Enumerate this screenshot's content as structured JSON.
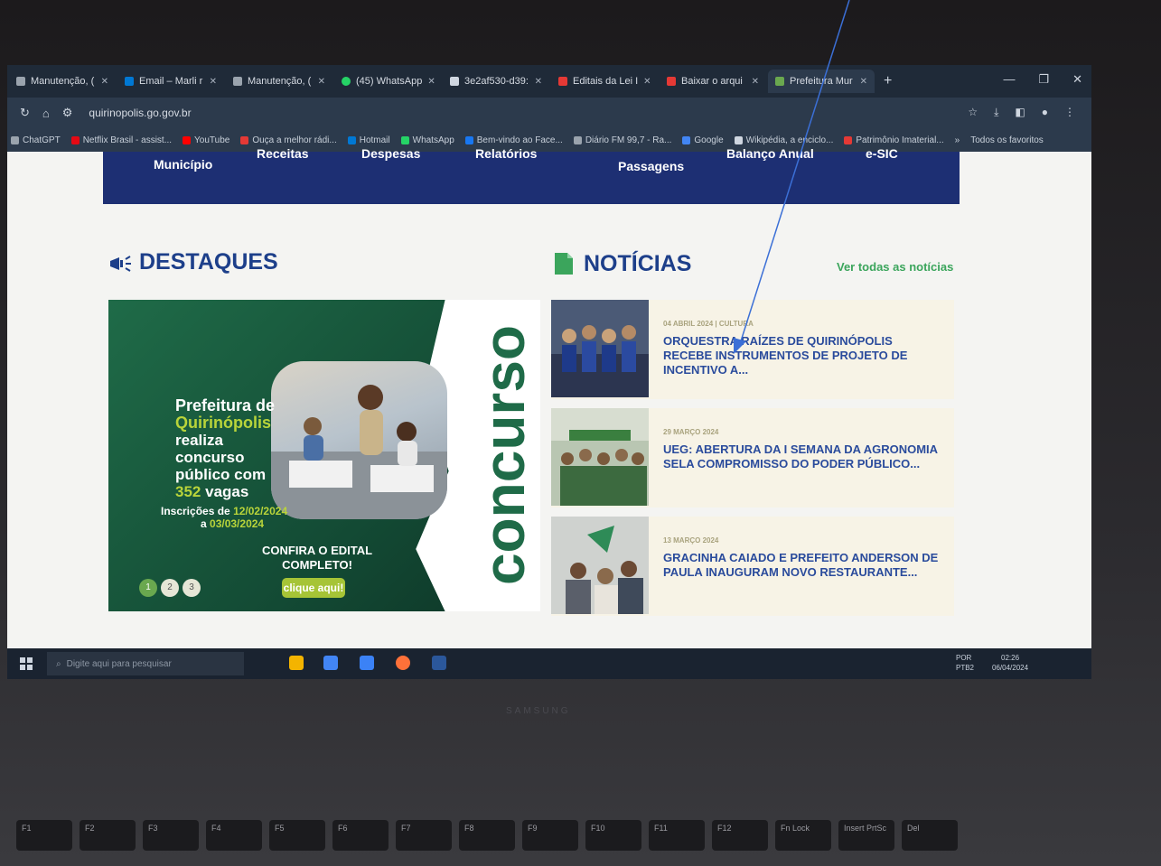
{
  "browser": {
    "tabs": [
      {
        "label": "Manutenção, ("
      },
      {
        "label": "Email – Marli r"
      },
      {
        "label": "Manutenção, ("
      },
      {
        "label": "(45) WhatsApp"
      },
      {
        "label": "3e2af530-d39:"
      },
      {
        "label": "Editais da Lei I"
      },
      {
        "label": "Baixar o arqui"
      },
      {
        "label": "Prefeitura Mur"
      }
    ],
    "new_tab": "+",
    "url": "quirinopolis.go.gov.br",
    "bookmarks": [
      {
        "label": "ChatGPT",
        "color": "#9aa3ad"
      },
      {
        "label": "Netflix Brasil - assist...",
        "color": "#e50914"
      },
      {
        "label": "YouTube",
        "color": "#ff0000"
      },
      {
        "label": "Ouça a melhor rádi...",
        "color": "#e53935"
      },
      {
        "label": "Hotmail",
        "color": "#0078d4"
      },
      {
        "label": "WhatsApp",
        "color": "#25d366"
      },
      {
        "label": "Bem-vindo ao Face...",
        "color": "#1877f2"
      },
      {
        "label": "Diário FM 99,7 - Ra...",
        "color": "#9aa3ad"
      },
      {
        "label": "Google",
        "color": "#4285f4"
      },
      {
        "label": "Wikipédia, a enciclo...",
        "color": "#cfd6e0"
      },
      {
        "label": "Patrimônio Imaterial...",
        "color": "#e53935"
      }
    ],
    "bookmarks_more": "»",
    "all_favorites": "Todos os favoritos"
  },
  "site": {
    "menu": [
      "Município",
      "Receitas",
      "Despesas",
      "Relatórios",
      "Passagens",
      "Balanço Anual",
      "e-SIC"
    ],
    "destaques_title": "DESTAQUES",
    "noticias_title": "NOTÍCIAS",
    "see_all": "Ver todas as notícias",
    "banner": {
      "vertical_word": "concurso",
      "line1": "Prefeitura de",
      "line2": "Quirinópolis",
      "line3": "realiza",
      "line4": "concurso",
      "line5": "público com",
      "vagas_number": "352",
      "vagas_word": "vagas",
      "inscricoes_label": "Inscrições de",
      "date_start": "12/02/2024",
      "date_sep": "a",
      "date_end": "03/03/2024",
      "cta_line1": "CONFIRA O EDITAL",
      "cta_line2": "COMPLETO!",
      "button": "clique aqui!",
      "pages": [
        "1",
        "2",
        "3"
      ]
    },
    "news": [
      {
        "date": "04 ABRIL 2024 | CULTURA",
        "title": "ORQUESTRA RAÍZES DE QUIRINÓPOLIS RECEBE INSTRUMENTOS DE PROJETO DE INCENTIVO A..."
      },
      {
        "date": "29 MARÇO 2024",
        "title": "UEG: ABERTURA DA I SEMANA DA AGRONOMIA SELA COMPROMISSO DO PODER PÚBLICO..."
      },
      {
        "date": "13 MARÇO 2024",
        "title": "GRACINHA CAIADO E PREFEITO ANDERSON DE PAULA INAUGURAM NOVO RESTAURANTE..."
      }
    ]
  },
  "taskbar": {
    "search_placeholder": "Digite aqui para pesquisar",
    "lang": "POR",
    "layout": "PTB2",
    "time": "02:26",
    "date": "06/04/2024"
  },
  "laptop": {
    "brand": "SAMSUNG",
    "fkeys": [
      "F1",
      "F2",
      "F3",
      "F4",
      "F5",
      "F6",
      "F7",
      "F8",
      "F9",
      "F10",
      "F11",
      "F12",
      "Fn Lock",
      "Insert PrtSc",
      "Del"
    ]
  },
  "colors": {
    "menu_bg": "#1d2f73",
    "title_blue": "#1d3f8a",
    "accent_green": "#3ba55c",
    "annotation_arrow": "#3b6fd6"
  }
}
